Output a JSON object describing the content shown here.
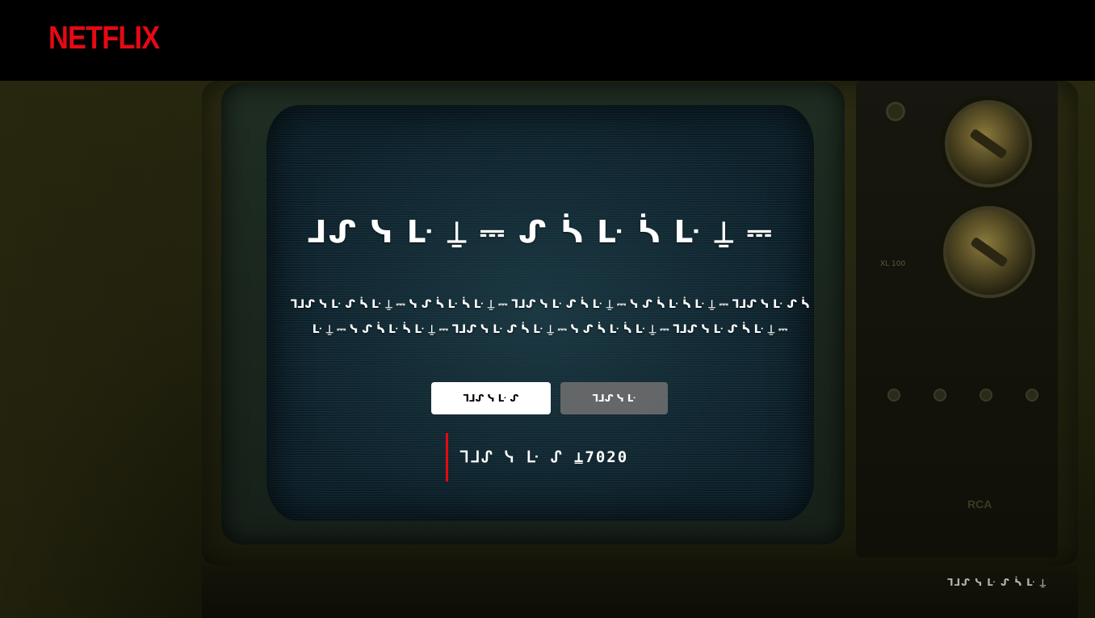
{
  "brand": {
    "logo_text": "NETFLIX",
    "color": "#e50914"
  },
  "error_page": {
    "headline": "ᒧᔑ ᓭ ᒷ ⍊ ⎓ ᔑ ᓵ ᒷ ᓵ ᒷ ⍊ ⎓",
    "description": "ᒣᒧᔑ ᓭ ᒷ ᔑ ᓵ ᒷ ⍊ ⎓ ᓭ ᔑ ᓵ ᒷ ᓵ ᒷ ⍊ ⎓ ᒣᒧᔑ ᓭ ᒷ ᔑ ᓵ ᒷ ⍊ ⎓ ᓭ ᔑ ᓵ ᒷ ᓵ ᒷ ⍊ ⎓ ᒣᒧᔑ ᓭ ᒷ ᔑ ᓵ ᒷ ⍊ ⎓ ᓭ ᔑ ᓵ ᒷ ᓵ ᒷ ⍊ ⎓ ᒣᒧᔑ ᓭ ᒷ ᔑ ᓵ ᒷ ⍊ ⎓ ᓭ ᔑ ᓵ ᒷ ᓵ ᒷ ⍊ ⎓ ᒣᒧᔑ ᓭ ᒷ ᔑ ᓵ ᒷ ⍊ ⎓",
    "primary_button": "ᒣᒧᔑ ᓭ ᒷ ᔑ",
    "secondary_button": "ᒣᒧᔑ ᓭ ᒷ",
    "error_code": "ᒣᒧᔑ ᓭ ᒷ ᔑ ⍊7020",
    "credit": "ᒣᒧᔑ ᓭ ᒷ ᔑ ᓵ ᒷ ⍊"
  },
  "tv": {
    "model_label": "XL 100",
    "brand": "RCA"
  }
}
